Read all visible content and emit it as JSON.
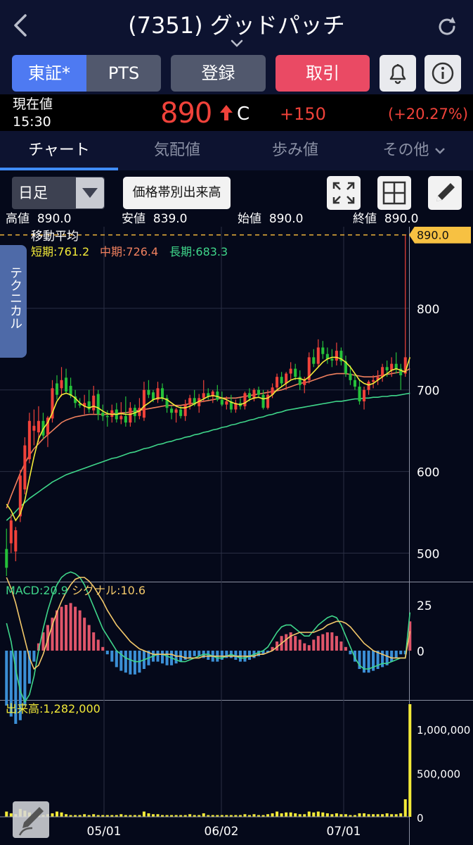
{
  "header": {
    "title": "(7351) グッドパッチ",
    "back_icon": "chevron-left-icon",
    "refresh_icon": "refresh-icon"
  },
  "buttons": {
    "tse": "東証*",
    "pts": "PTS",
    "register": "登録",
    "trade": "取引"
  },
  "price": {
    "label": "現在値",
    "time": "15:30",
    "value": "890",
    "flag": "C",
    "change": "+150",
    "change_pct": "(+20.27%)"
  },
  "tabs": [
    {
      "label": "チャート"
    },
    {
      "label": "気配値"
    },
    {
      "label": "歩み値"
    },
    {
      "label": "その他"
    }
  ],
  "controls": {
    "period": "日足",
    "volume_by_price": "価格帯別出来高"
  },
  "ohlc": {
    "high_label": "高値",
    "high": "890.0",
    "low_label": "安値",
    "low": "839.0",
    "open_label": "始値",
    "open": "890.0",
    "close_label": "終値",
    "close": "890.0"
  },
  "technical_tab": "テクニカル",
  "moving_average": {
    "title": "移動平均",
    "short": "短期:761.2",
    "mid": "中期:726.4",
    "long": "長期:683.3"
  },
  "macd": {
    "macd": "MACD:20.9",
    "signal": "シグナル:10.6"
  },
  "volume": {
    "label": "出来高:1,282,000"
  },
  "colors": {
    "up": "#f0423a",
    "down": "#25c13a",
    "short_ma": "#f3ea38",
    "mid_ma": "#f0805e",
    "long_ma": "#3fd68a",
    "accent": "#3f8cff"
  },
  "chart_data": {
    "type": "candlestick",
    "price_axis": {
      "ticks": [
        500,
        600,
        700,
        800
      ],
      "current_label": "890.0",
      "ylim": [
        465,
        900
      ]
    },
    "macd_axis": {
      "ticks": [
        25,
        0
      ]
    },
    "volume_axis": {
      "ticks": [
        "1,000,000",
        "500,000",
        "0"
      ]
    },
    "x_labels": [
      "05/01",
      "06/02",
      "07/01"
    ],
    "candles": [
      {
        "o": 505,
        "h": 530,
        "l": 472,
        "c": 482
      },
      {
        "o": 512,
        "h": 548,
        "l": 500,
        "c": 540
      },
      {
        "o": 502,
        "h": 532,
        "l": 490,
        "c": 528
      },
      {
        "o": 545,
        "h": 602,
        "l": 538,
        "c": 595
      },
      {
        "o": 578,
        "h": 642,
        "l": 572,
        "c": 632
      },
      {
        "o": 615,
        "h": 672,
        "l": 610,
        "c": 662
      },
      {
        "o": 650,
        "h": 676,
        "l": 632,
        "c": 656
      },
      {
        "o": 648,
        "h": 680,
        "l": 636,
        "c": 662
      },
      {
        "o": 662,
        "h": 672,
        "l": 640,
        "c": 644
      },
      {
        "o": 645,
        "h": 668,
        "l": 630,
        "c": 666
      },
      {
        "o": 665,
        "h": 712,
        "l": 660,
        "c": 702
      },
      {
        "o": 708,
        "h": 718,
        "l": 688,
        "c": 694
      },
      {
        "o": 702,
        "h": 728,
        "l": 692,
        "c": 712
      },
      {
        "o": 715,
        "h": 726,
        "l": 696,
        "c": 698
      },
      {
        "o": 705,
        "h": 715,
        "l": 690,
        "c": 693
      },
      {
        "o": 692,
        "h": 700,
        "l": 678,
        "c": 684
      },
      {
        "o": 683,
        "h": 690,
        "l": 678,
        "c": 681
      },
      {
        "o": 680,
        "h": 694,
        "l": 670,
        "c": 684
      },
      {
        "o": 686,
        "h": 700,
        "l": 672,
        "c": 676
      },
      {
        "o": 675,
        "h": 705,
        "l": 670,
        "c": 693
      },
      {
        "o": 695,
        "h": 700,
        "l": 663,
        "c": 670
      },
      {
        "o": 672,
        "h": 682,
        "l": 662,
        "c": 668
      },
      {
        "o": 668,
        "h": 675,
        "l": 655,
        "c": 667
      },
      {
        "o": 667,
        "h": 682,
        "l": 660,
        "c": 675
      },
      {
        "o": 676,
        "h": 684,
        "l": 660,
        "c": 664
      },
      {
        "o": 664,
        "h": 685,
        "l": 658,
        "c": 668
      },
      {
        "o": 668,
        "h": 692,
        "l": 655,
        "c": 660
      },
      {
        "o": 660,
        "h": 685,
        "l": 655,
        "c": 678
      },
      {
        "o": 678,
        "h": 682,
        "l": 660,
        "c": 668
      },
      {
        "o": 668,
        "h": 690,
        "l": 664,
        "c": 678
      },
      {
        "o": 666,
        "h": 710,
        "l": 662,
        "c": 700
      },
      {
        "o": 700,
        "h": 712,
        "l": 690,
        "c": 694
      },
      {
        "o": 697,
        "h": 700,
        "l": 685,
        "c": 688
      },
      {
        "o": 688,
        "h": 710,
        "l": 684,
        "c": 702
      },
      {
        "o": 702,
        "h": 708,
        "l": 686,
        "c": 690
      },
      {
        "o": 690,
        "h": 694,
        "l": 672,
        "c": 678
      },
      {
        "o": 677,
        "h": 680,
        "l": 664,
        "c": 672
      },
      {
        "o": 672,
        "h": 678,
        "l": 660,
        "c": 676
      },
      {
        "o": 676,
        "h": 680,
        "l": 665,
        "c": 668
      },
      {
        "o": 668,
        "h": 688,
        "l": 662,
        "c": 682
      },
      {
        "o": 682,
        "h": 694,
        "l": 676,
        "c": 690
      },
      {
        "o": 690,
        "h": 700,
        "l": 680,
        "c": 682
      },
      {
        "o": 680,
        "h": 695,
        "l": 672,
        "c": 690
      },
      {
        "o": 690,
        "h": 712,
        "l": 685,
        "c": 696
      },
      {
        "o": 696,
        "h": 702,
        "l": 688,
        "c": 692
      },
      {
        "o": 692,
        "h": 700,
        "l": 684,
        "c": 698
      },
      {
        "o": 698,
        "h": 706,
        "l": 686,
        "c": 688
      },
      {
        "o": 688,
        "h": 698,
        "l": 680,
        "c": 682
      },
      {
        "o": 682,
        "h": 692,
        "l": 676,
        "c": 686
      },
      {
        "o": 686,
        "h": 694,
        "l": 672,
        "c": 676
      },
      {
        "o": 676,
        "h": 688,
        "l": 672,
        "c": 684
      },
      {
        "o": 684,
        "h": 690,
        "l": 676,
        "c": 680
      },
      {
        "o": 680,
        "h": 698,
        "l": 676,
        "c": 696
      },
      {
        "o": 696,
        "h": 702,
        "l": 686,
        "c": 690
      },
      {
        "o": 690,
        "h": 702,
        "l": 686,
        "c": 700
      },
      {
        "o": 700,
        "h": 704,
        "l": 690,
        "c": 694
      },
      {
        "o": 694,
        "h": 700,
        "l": 676,
        "c": 678
      },
      {
        "o": 678,
        "h": 700,
        "l": 676,
        "c": 694
      },
      {
        "o": 694,
        "h": 708,
        "l": 690,
        "c": 703
      },
      {
        "o": 703,
        "h": 720,
        "l": 700,
        "c": 716
      },
      {
        "o": 716,
        "h": 722,
        "l": 704,
        "c": 708
      },
      {
        "o": 708,
        "h": 722,
        "l": 700,
        "c": 720
      },
      {
        "o": 720,
        "h": 734,
        "l": 712,
        "c": 726
      },
      {
        "o": 726,
        "h": 732,
        "l": 712,
        "c": 716
      },
      {
        "o": 716,
        "h": 724,
        "l": 700,
        "c": 706
      },
      {
        "o": 706,
        "h": 716,
        "l": 696,
        "c": 712
      },
      {
        "o": 712,
        "h": 746,
        "l": 708,
        "c": 740
      },
      {
        "o": 740,
        "h": 750,
        "l": 728,
        "c": 732
      },
      {
        "o": 732,
        "h": 762,
        "l": 728,
        "c": 752
      },
      {
        "o": 752,
        "h": 760,
        "l": 738,
        "c": 744
      },
      {
        "o": 744,
        "h": 752,
        "l": 732,
        "c": 738
      },
      {
        "o": 738,
        "h": 750,
        "l": 728,
        "c": 736
      },
      {
        "o": 736,
        "h": 758,
        "l": 730,
        "c": 748
      },
      {
        "o": 748,
        "h": 752,
        "l": 730,
        "c": 735
      },
      {
        "o": 735,
        "h": 742,
        "l": 716,
        "c": 720
      },
      {
        "o": 720,
        "h": 730,
        "l": 706,
        "c": 712
      },
      {
        "o": 712,
        "h": 720,
        "l": 700,
        "c": 704
      },
      {
        "o": 704,
        "h": 712,
        "l": 682,
        "c": 686
      },
      {
        "o": 686,
        "h": 704,
        "l": 676,
        "c": 700
      },
      {
        "o": 700,
        "h": 712,
        "l": 694,
        "c": 710
      },
      {
        "o": 710,
        "h": 718,
        "l": 702,
        "c": 712
      },
      {
        "o": 712,
        "h": 724,
        "l": 706,
        "c": 716
      },
      {
        "o": 716,
        "h": 732,
        "l": 710,
        "c": 728
      },
      {
        "o": 728,
        "h": 736,
        "l": 716,
        "c": 724
      },
      {
        "o": 724,
        "h": 740,
        "l": 716,
        "c": 732
      },
      {
        "o": 732,
        "h": 746,
        "l": 720,
        "c": 726
      },
      {
        "o": 726,
        "h": 732,
        "l": 700,
        "c": 718
      },
      {
        "o": 720,
        "h": 890,
        "l": 716,
        "c": 740
      }
    ],
    "sma_short": [
      560,
      552,
      540,
      548,
      565,
      592,
      618,
      640,
      652,
      660,
      672,
      686,
      694,
      696,
      694,
      690,
      684,
      680,
      678,
      680,
      678,
      674,
      671,
      670,
      670,
      671,
      670,
      670,
      672,
      674,
      680,
      684,
      688,
      690,
      690,
      688,
      684,
      680,
      678,
      678,
      680,
      683,
      686,
      689,
      692,
      693,
      692,
      690,
      688,
      685,
      683,
      682,
      684,
      688,
      690,
      691,
      689,
      690,
      694,
      700,
      704,
      708,
      712,
      714,
      714,
      712,
      716,
      722,
      728,
      734,
      738,
      740,
      740,
      738,
      734,
      728,
      720,
      712,
      708,
      706,
      708,
      712,
      716,
      720,
      724,
      726,
      724,
      722,
      740
    ],
    "sma_mid": [
      555,
      570,
      584,
      598,
      610,
      620,
      628,
      634,
      640,
      645,
      650,
      655,
      660,
      663,
      665,
      667,
      668,
      669,
      670,
      670,
      670,
      670,
      670,
      671,
      671,
      672,
      672,
      673,
      674,
      675,
      676,
      677,
      678,
      679,
      680,
      681,
      681,
      681,
      681,
      682,
      683,
      684,
      685,
      686,
      687,
      688,
      689,
      690,
      690,
      690,
      690,
      691,
      692,
      693,
      694,
      695,
      696,
      697,
      698,
      699,
      700,
      702,
      704,
      706,
      708,
      709,
      710,
      712,
      714,
      716,
      718,
      719,
      720,
      720,
      720,
      719,
      718,
      717,
      716,
      716,
      716,
      717,
      718,
      719,
      720,
      721,
      722,
      723,
      726
    ],
    "sma_long": [
      540,
      545,
      551,
      557,
      562,
      567,
      571,
      575,
      579,
      583,
      587,
      590,
      593,
      596,
      598,
      600,
      602,
      604,
      606,
      608,
      610,
      612,
      614,
      616,
      617,
      619,
      621,
      623,
      624,
      626,
      628,
      629,
      631,
      633,
      634,
      636,
      637,
      639,
      640,
      642,
      643,
      645,
      646,
      648,
      649,
      651,
      652,
      654,
      655,
      657,
      658,
      660,
      661,
      663,
      664,
      666,
      667,
      669,
      670,
      672,
      673,
      675,
      676,
      677,
      678,
      679,
      680,
      681,
      682,
      683,
      684,
      685,
      686,
      686,
      687,
      688,
      689,
      689,
      690,
      690,
      691,
      691,
      692,
      692,
      693,
      693,
      694,
      695,
      696
    ],
    "macd_hist": [
      -30,
      -36,
      -40,
      -38,
      -30,
      -18,
      -6,
      4,
      10,
      14,
      18,
      22,
      24,
      25,
      26,
      24,
      22,
      18,
      14,
      10,
      6,
      2,
      -2,
      -6,
      -9,
      -11,
      -12,
      -13,
      -13,
      -12,
      -10,
      -8,
      -6,
      -6,
      -7,
      -8,
      -8,
      -7,
      -6,
      -5,
      -4,
      -3,
      -3,
      -4,
      -5,
      -6,
      -6,
      -5,
      -4,
      -4,
      -5,
      -6,
      -6,
      -5,
      -4,
      -3,
      -2,
      -1,
      2,
      5,
      8,
      9,
      10,
      8,
      6,
      4,
      3,
      6,
      8,
      9,
      10,
      10,
      8,
      5,
      2,
      -2,
      -6,
      -10,
      -12,
      -12,
      -11,
      -10,
      -9,
      -8,
      -6,
      -4,
      -2,
      -2,
      16
    ],
    "macd_line": [
      15,
      5,
      -10,
      -22,
      -28,
      -24,
      -14,
      0,
      12,
      22,
      30,
      36,
      40,
      42,
      43,
      42,
      40,
      36,
      30,
      24,
      18,
      12,
      8,
      4,
      0,
      -2,
      -4,
      -5,
      -6,
      -6,
      -5,
      -4,
      -3,
      -2,
      -2,
      -3,
      -4,
      -5,
      -6,
      -6,
      -5,
      -4,
      -3,
      -2,
      -2,
      -3,
      -4,
      -4,
      -3,
      -2,
      -3,
      -4,
      -4,
      -3,
      -2,
      -1,
      0,
      2,
      6,
      10,
      13,
      14,
      14,
      12,
      10,
      8,
      8,
      11,
      14,
      16,
      18,
      19,
      18,
      14,
      8,
      2,
      -4,
      -8,
      -10,
      -10,
      -9,
      -8,
      -7,
      -7,
      -6,
      -5,
      -4,
      -4,
      20.9
    ],
    "macd_signal": [
      40,
      34,
      26,
      16,
      6,
      -4,
      -10,
      -8,
      -2,
      6,
      14,
      21,
      27,
      32,
      36,
      39,
      40,
      40,
      38,
      35,
      31,
      27,
      22,
      18,
      14,
      11,
      8,
      5,
      3,
      1,
      0,
      -1,
      -2,
      -2,
      -2,
      -2,
      -2,
      -3,
      -3,
      -4,
      -4,
      -4,
      -4,
      -3,
      -3,
      -3,
      -3,
      -3,
      -3,
      -3,
      -3,
      -3,
      -3,
      -3,
      -3,
      -2,
      -2,
      -1,
      0,
      2,
      4,
      6,
      8,
      9,
      10,
      10,
      10,
      10,
      11,
      12,
      14,
      15,
      16,
      16,
      15,
      13,
      10,
      7,
      4,
      2,
      0,
      -1,
      -2,
      -3,
      -4,
      -4,
      -4,
      -4,
      10.6
    ],
    "volume": [
      60000,
      40000,
      30000,
      90000,
      70000,
      50000,
      30000,
      20000,
      20000,
      30000,
      40000,
      60000,
      50000,
      30000,
      20000,
      20000,
      20000,
      30000,
      20000,
      30000,
      20000,
      20000,
      20000,
      20000,
      20000,
      30000,
      20000,
      20000,
      20000,
      20000,
      60000,
      40000,
      30000,
      30000,
      20000,
      20000,
      20000,
      20000,
      20000,
      20000,
      30000,
      20000,
      20000,
      40000,
      20000,
      20000,
      20000,
      20000,
      20000,
      20000,
      20000,
      20000,
      30000,
      20000,
      30000,
      20000,
      20000,
      30000,
      40000,
      60000,
      40000,
      50000,
      50000,
      40000,
      30000,
      30000,
      60000,
      50000,
      60000,
      50000,
      40000,
      30000,
      40000,
      30000,
      30000,
      20000,
      20000,
      40000,
      40000,
      30000,
      30000,
      30000,
      30000,
      40000,
      30000,
      30000,
      40000,
      200000,
      1282000
    ]
  }
}
